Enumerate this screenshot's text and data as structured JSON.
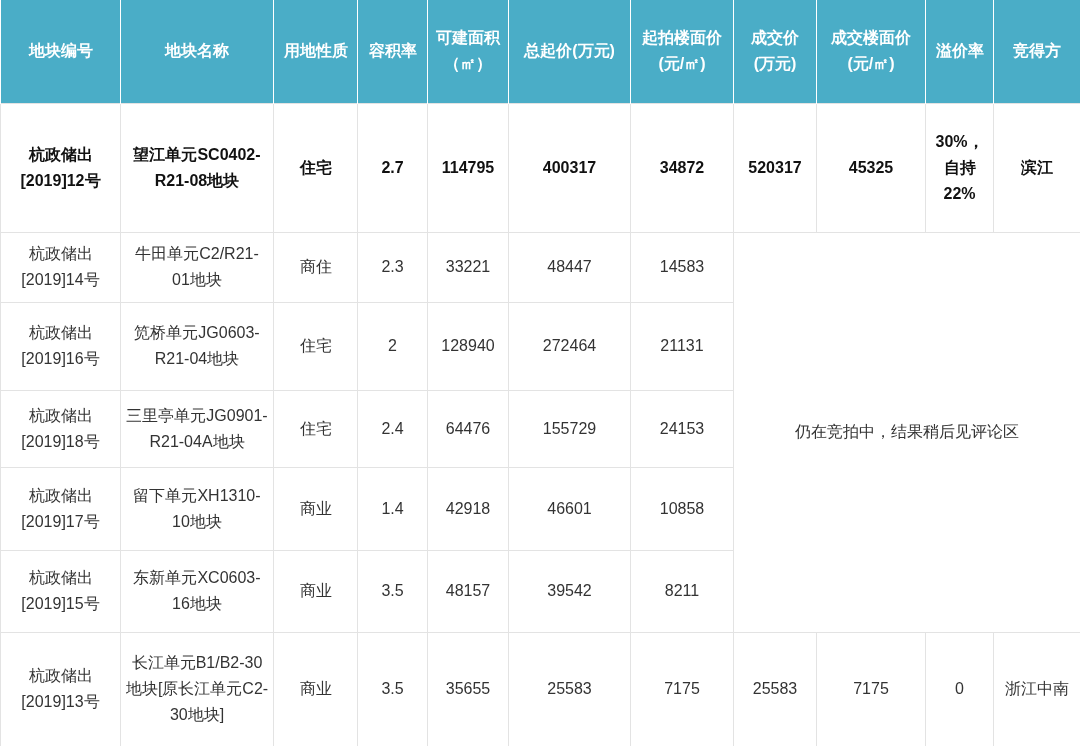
{
  "table": {
    "columns": [
      "地块编号",
      "地块名称",
      "用地性质",
      "容积率",
      "可建面积（㎡）",
      "总起价(万元)",
      "起拍楼面价(元/㎡)",
      "成交价(万元)",
      "成交楼面价(元/㎡)",
      "溢价率",
      "竞得方"
    ],
    "rows": [
      {
        "bold": true,
        "cells": [
          "杭政储出\n[2019]12号",
          "望江单元SC0402-\nR21-08地块",
          "住宅",
          "2.7",
          "114795",
          "400317",
          "34872",
          "520317",
          "45325",
          "30%，自持22%",
          "滨江"
        ]
      },
      {
        "bold": false,
        "cells": [
          "杭政储出\n[2019]14号",
          "牛田单元C2/R21-\n01地块",
          "商住",
          "2.3",
          "33221",
          "48447",
          "14583"
        ]
      },
      {
        "bold": false,
        "cells": [
          "杭政储出\n[2019]16号",
          "笕桥单元JG0603-\nR21-04地块",
          "住宅",
          "2",
          "128940",
          "272464",
          "21131"
        ]
      },
      {
        "bold": false,
        "cells": [
          "杭政储出\n[2019]18号",
          "三里亭单元JG0901-R21-04A地块",
          "住宅",
          "2.4",
          "64476",
          "155729",
          "24153"
        ]
      },
      {
        "bold": false,
        "cells": [
          "杭政储出\n[2019]17号",
          "留下单元XH1310-\n10地块",
          "商业",
          "1.4",
          "42918",
          "46601",
          "10858"
        ]
      },
      {
        "bold": false,
        "cells": [
          "杭政储出\n[2019]15号",
          "东新单元XC0603-\n16地块",
          "商业",
          "3.5",
          "48157",
          "39542",
          "8211"
        ]
      },
      {
        "bold": false,
        "cells": [
          "杭政储出\n[2019]13号",
          "长江单元B1/B2-30地块[原长江单元C2-30地块]",
          "商业",
          "3.5",
          "35655",
          "25583",
          "7175",
          "25583",
          "7175",
          "0",
          "浙江中南"
        ]
      }
    ],
    "pending_note": "仍在竞拍中，结果稍后见评论区"
  }
}
